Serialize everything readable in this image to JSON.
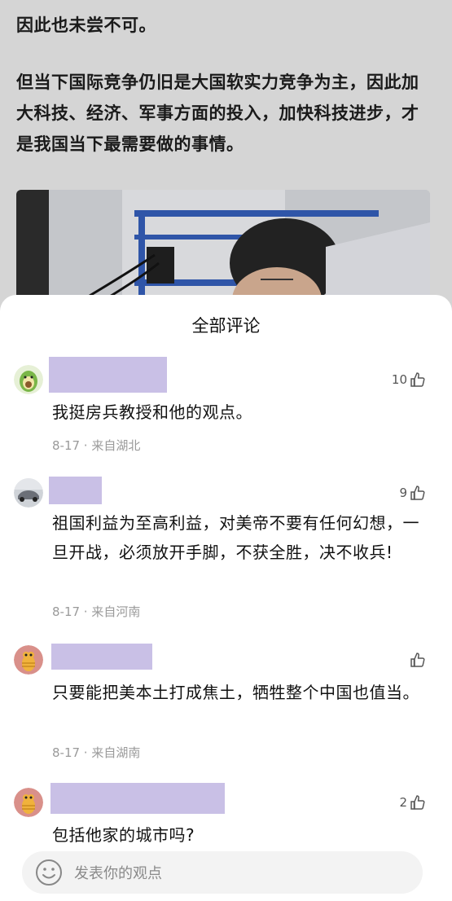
{
  "article": {
    "paragraph1": "因此也未尝不可。",
    "paragraph2": "但当下国际竞争仍旧是大国软实力竞争为主，因此加大科技、经济、军事方面的投入，加快科技进步，才是我国当下最需要做的事情。"
  },
  "comments_sheet": {
    "title": "全部评论",
    "comments": [
      {
        "text": "我挺房兵教授和他的观点。",
        "meta": "8-17 · 来自湖北",
        "likes": "10"
      },
      {
        "text": "祖国利益为至高利益，对美帝不要有任何幻想，一旦开战，必须放开手脚，不获全胜，决不收兵!",
        "meta": "8-17 · 来自河南",
        "likes": "9"
      },
      {
        "text": "只要能把美本土打成焦土，牺牲整个中国也值当。",
        "meta": "8-17 · 来自湖南",
        "likes": ""
      },
      {
        "text": "包括他家的城市吗?",
        "meta": "",
        "likes": "2"
      }
    ]
  },
  "input_bar": {
    "placeholder": "发表你的观点"
  },
  "colors": {
    "redacted_name": "#c9c0e6",
    "sheet_background": "#ffffff",
    "overlay_background": "#d5d5d5"
  }
}
